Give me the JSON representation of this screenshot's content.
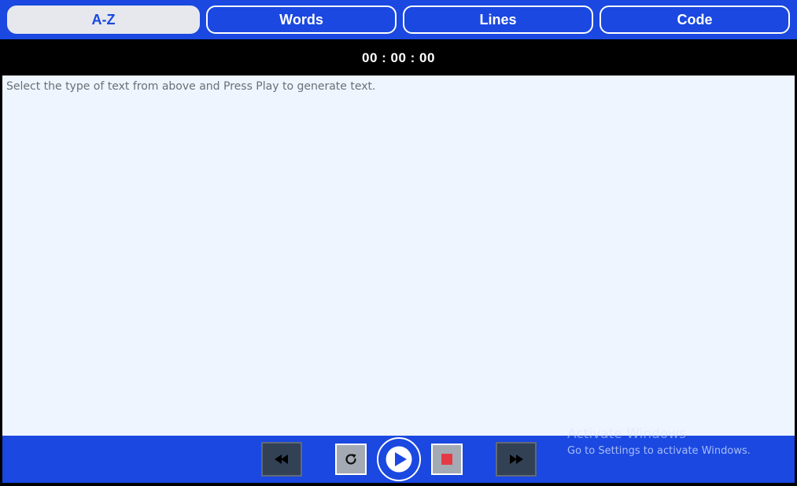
{
  "tabs": [
    {
      "label": "A-Z",
      "active": true
    },
    {
      "label": "Words",
      "active": false
    },
    {
      "label": "Lines",
      "active": false
    },
    {
      "label": "Code",
      "active": false
    }
  ],
  "timer": "00 : 00 : 00",
  "text_area": {
    "prompt": "Select the type of text from above and Press Play to generate text."
  },
  "controls": {
    "icons": [
      "rewind-icon",
      "restart-icon",
      "play-icon",
      "stop-icon",
      "fast-forward-icon"
    ]
  },
  "watermark": {
    "title": "Activate Windows",
    "subtitle": "Go to Settings to activate Windows."
  },
  "colors": {
    "accent": "#1a48e0",
    "active_tab_bg": "#e6e8ee",
    "text_area_bg": "#eef5ff",
    "stop": "#e63946",
    "dark_button": "#334155",
    "gray_button": "#a4aab4"
  }
}
